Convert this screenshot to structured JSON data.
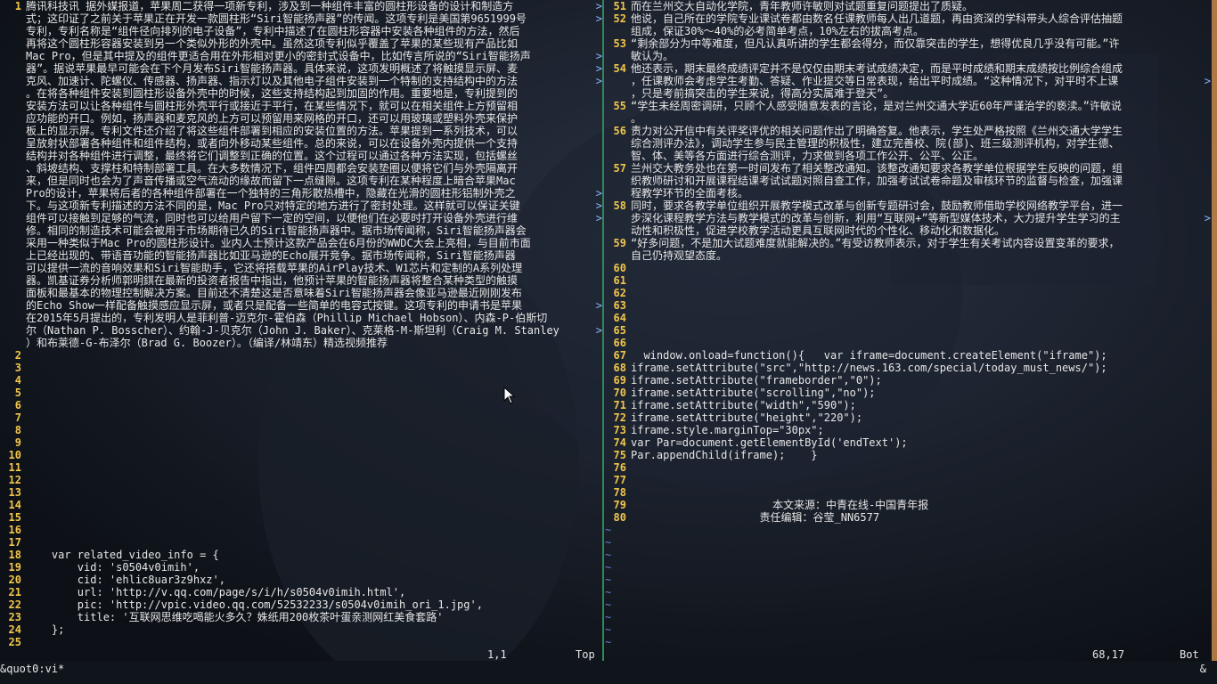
{
  "colors": {
    "line_number": "#f2c64a",
    "tilde": "#5e83c8",
    "divider": "#2f8a5a",
    "text": "#e6e6e6"
  },
  "left": {
    "lines": [
      {
        "ln": "1",
        "text": "腾讯科技讯 据外媒报道，苹果周二获得一项新专利，涉及到一种组件丰富的圆柱形设备的设计和制造方"
      },
      {
        "ln": "",
        "text": "式；这印证了之前关于苹果正在开发一款圆柱形“Siri智能扬声器”的传闻。这项专利是美国第9651999号"
      },
      {
        "ln": "",
        "text": "专利，专利名称是“组件径向排列的电子设备”，专利中描述了在圆柱形容器中安装各种组件的方法，然后"
      },
      {
        "ln": "",
        "text": "再将这个圆柱形容器安装到另一个类似外形的外壳中。虽然这项专利似乎覆盖了苹果的某些现有产品比如"
      },
      {
        "ln": "",
        "text": "Mac Pro，但是其中提及的组件更适合用在外形相对更小的密封式设备中，比如传言所说的“Siri智能扬声"
      },
      {
        "ln": "",
        "text": "器”。据说苹果最早可能会在下个月发布Siri智能扬声器。具体来说，这项发明概述了将触摸显示屏、麦"
      },
      {
        "ln": "",
        "text": "克风、加速计、陀螺仪、传感器、扬声器、指示灯以及其他电子组件安装到一个特制的支持结构中的方法"
      },
      {
        "ln": "",
        "text": "。在将各种组件安装到圆柱形设备外壳中的时候，这些支持结构起到加固的作用。重要地是，专利提到的"
      },
      {
        "ln": "",
        "text": "安装方法可以让各种组件与圆柱形外壳平行或接近于平行，在某些情况下，就可以在相关组件上方预留相"
      },
      {
        "ln": "",
        "text": "应功能的开口。例如，扬声器和麦克风的上方可以预留用来网格的开口，还可以用玻璃或塑料外壳来保护"
      },
      {
        "ln": "",
        "text": "板上的显示屏。专利文件还介绍了将这些组件部署到相应的安装位置的方法。苹果提到一系列技术，可以"
      },
      {
        "ln": "",
        "text": "呈放射状部署各种组件和组件结构，或者向外移动某些组件。总的来说，可以在设备外壳内提供一个支持"
      },
      {
        "ln": "",
        "text": "结构并对各种组件进行调整，最终将它们调整到正确的位置。这个过程可以通过各种方法实现，包括螺丝"
      },
      {
        "ln": "",
        "text": "、斜坡结构、支撑柱和特制部署工具。在大多数情况下，组件四周都会安装垫圈以便将它们与外壳隔离开"
      },
      {
        "ln": "",
        "text": "来，但是同时也会为了声音传播或空气流动的缘故而留下一点缝隙。这项专利在某种程度上暗合苹果Mac"
      },
      {
        "ln": "",
        "text": "Pro的设计，苹果将后者的各种组件部署在一个独特的三角形散热槽中，隐藏在光滑的圆柱形铝制外壳之"
      },
      {
        "ln": "",
        "text": "下。与这项新专利描述的方法不同的是，Mac Pro只对特定的地方进行了密封处理。这样就可以保证关键"
      },
      {
        "ln": "",
        "text": "组件可以接触到足够的气流，同时也可以给用户留下一定的空间，以便他们在必要时打开设备外壳进行维"
      },
      {
        "ln": "",
        "text": "修。相同的制造技术可能会被用于市场期待已久的Siri智能扬声器中。据市场传闻称，Siri智能扬声器会"
      },
      {
        "ln": "",
        "text": "采用一种类似于Mac Pro的圆柱形设计。业内人士预计这款产品会在6月份的WWDC大会上亮相，与目前市面"
      },
      {
        "ln": "",
        "text": "上已经出现的、带语音功能的智能扬声器比如亚马逊的Echo展开竞争。据市场传闻称，Siri智能扬声器"
      },
      {
        "ln": "",
        "text": "可以提供一流的音响效果和Siri智能助手，它还将搭载苹果的AirPlay技术、W1芯片和定制的A系列处理"
      },
      {
        "ln": "",
        "text": "器。凯基证券分析师郭明錤在最新的投资者报告中指出，他预计苹果的智能扬声器将整合某种类型的触摸"
      },
      {
        "ln": "",
        "text": "面板和最基本的物理控制解决方案。目前还不清楚这是否意味着Siri智能扬声器会像亚马逊最近刚刚发布"
      },
      {
        "ln": "",
        "text": "的Echo Show一样配备触摸感应显示屏，或者只是配备一些简单的电容式按键。这项专利的申请书是苹果"
      },
      {
        "ln": "",
        "text": "在2015年5月提出的，专利发明人是菲利普-迈克尔-霍伯森（Phillip Michael Hobson）、内森-P-伯斯切"
      },
      {
        "ln": "",
        "text": "尔（Nathan P. Bosscher）、约翰-J-贝克尔（John J. Baker）、克莱格-M-斯坦利（Craig M. Stanley"
      },
      {
        "ln": "",
        "text": "）和布莱德-G-布泽尔（Brad G. Boozer）。（编译/林靖东）精选视频推荐"
      },
      {
        "ln": "2",
        "text": ""
      },
      {
        "ln": "3",
        "text": ""
      },
      {
        "ln": "4",
        "text": ""
      },
      {
        "ln": "5",
        "text": ""
      },
      {
        "ln": "6",
        "text": ""
      },
      {
        "ln": "7",
        "text": ""
      },
      {
        "ln": "8",
        "text": ""
      },
      {
        "ln": "9",
        "text": ""
      },
      {
        "ln": "10",
        "text": ""
      },
      {
        "ln": "11",
        "text": ""
      },
      {
        "ln": "12",
        "text": ""
      },
      {
        "ln": "13",
        "text": ""
      },
      {
        "ln": "14",
        "text": ""
      },
      {
        "ln": "15",
        "text": ""
      },
      {
        "ln": "16",
        "text": ""
      },
      {
        "ln": "17",
        "text": ""
      },
      {
        "ln": "18",
        "text": "    var related_video_info = {"
      },
      {
        "ln": "19",
        "text": "        vid: 's0504v0imih',"
      },
      {
        "ln": "20",
        "text": "        cid: 'ehlic8uar3z9hxz',"
      },
      {
        "ln": "21",
        "text": "        url: 'http://v.qq.com/page/s/i/h/s0504v0imih.html',"
      },
      {
        "ln": "22",
        "text": "        pic: 'http://vpic.video.qq.com/52532233/s0504v0imih_ori_1.jpg',"
      },
      {
        "ln": "23",
        "text": "        title: '互联网思维吃喝能火多久？姝纸用200枚茶叶蛋亲测网红美食套路'"
      },
      {
        "ln": "24",
        "text": "    };"
      },
      {
        "ln": "25",
        "text": ""
      }
    ],
    "cont_rows": [
      0,
      1,
      4,
      5,
      6,
      15,
      16,
      17,
      24,
      26
    ],
    "status_pos": "1,1",
    "status_scroll": "Top"
  },
  "right": {
    "lines": [
      {
        "ln": "51",
        "text": "而在兰州交大自动化学院，青年教师许敏则对试题重复问题提出了质疑。"
      },
      {
        "ln": "52",
        "text": "他说，自己所在的学院专业课试卷都由数名任课教师每人出几道题，再由资深的学科带头人综合评估抽题"
      },
      {
        "ln": "",
        "text": "组成，保证30%～40%的必考简单考点，10%左右的拔高考点。"
      },
      {
        "ln": "53",
        "text": "“剩余部分为中等难度，但凡认真听讲的学生都会得分，而仅靠突击的学生，想得优良几乎没有可能。”许"
      },
      {
        "ln": "",
        "text": "敏认为。"
      },
      {
        "ln": "54",
        "text": "他还表示，期末最终成绩评定并不是仅仅由期末考试成绩决定，而是平时成绩和期末成绩按比例综合组成"
      },
      {
        "ln": "",
        "text": "，任课教师会考虑学生考勤、答疑、作业提交等日常表现，给出平时成绩。“这种情况下，对平时不上课"
      },
      {
        "ln": "",
        "text": "，只是考前搞突击的学生来说，得高分实属难于登天”。"
      },
      {
        "ln": "55",
        "text": "“学生未经周密调研，只顾个人感受随意发表的言论，是对兰州交通大学近60年严谨治学的亵渎。”许敏说"
      },
      {
        "ln": "",
        "text": "。"
      },
      {
        "ln": "56",
        "text": "责力对公开信中有关评奖评优的相关问题作出了明确答复。他表示，学生处严格按照《兰州交通大学学生"
      },
      {
        "ln": "",
        "text": "综合测评办法》，调动学生参与民主管理的积极性，建立完善校、院(部)、班三级测评机构，对学生德、"
      },
      {
        "ln": "",
        "text": "智、体、美等各方面进行综合测评，力求做到各项工作公开、公平、公正。"
      },
      {
        "ln": "57",
        "text": "兰州交大教务处也在第一时间发布了相关整改通知。该整改通知要求各教学单位根据学生反映的问题，组"
      },
      {
        "ln": "",
        "text": "织教师研讨和开展课程结课考试试题对照自查工作，加强考试试卷命题及审核环节的监督与检查，加强课"
      },
      {
        "ln": "",
        "text": "程教学环节的全面考核。"
      },
      {
        "ln": "58",
        "text": "同时，要求各教学单位组织开展教学模式改革与创新专题研讨会，鼓励教师借助学校网络教学平台，进一"
      },
      {
        "ln": "",
        "text": "步深化课程教学方法与教学模式的改革与创新，利用“互联网+”等新型媒体技术，大力提升学生学习的主"
      },
      {
        "ln": "",
        "text": "动性和积极性，促进学校教学活动更具互联网时代的个性化、移动化和数据化。"
      },
      {
        "ln": "59",
        "text": "“好多问题，不是加大试题难度就能解决的。”有受访教师表示，对于学生有关考试内容设置变革的要求，"
      },
      {
        "ln": "",
        "text": "自己仍持观望态度。"
      },
      {
        "ln": "60",
        "text": ""
      },
      {
        "ln": "61",
        "text": ""
      },
      {
        "ln": "62",
        "text": ""
      },
      {
        "ln": "63",
        "text": ""
      },
      {
        "ln": "64",
        "text": ""
      },
      {
        "ln": "65",
        "text": ""
      },
      {
        "ln": "66",
        "text": ""
      },
      {
        "ln": "67",
        "text": "  window.onload=function(){   var iframe=document.createElement(\"iframe\");"
      },
      {
        "ln": "68",
        "text": "iframe.setAttribute(\"src\",\"http://news.163.com/special/today_must_news/\");"
      },
      {
        "ln": "69",
        "text": "iframe.setAttribute(\"frameborder\",\"0\");"
      },
      {
        "ln": "70",
        "text": "iframe.setAttribute(\"scrolling\",\"no\");"
      },
      {
        "ln": "71",
        "text": "iframe.setAttribute(\"width\",\"590\");"
      },
      {
        "ln": "72",
        "text": "iframe.setAttribute(\"height\",\"220\");"
      },
      {
        "ln": "73",
        "text": "iframe.style.marginTop=\"30px\";"
      },
      {
        "ln": "74",
        "text": "var Par=document.getElementById('endText');"
      },
      {
        "ln": "75",
        "text": "Par.appendChild(iframe);    }"
      },
      {
        "ln": "76",
        "text": ""
      },
      {
        "ln": "77",
        "text": ""
      },
      {
        "ln": "78",
        "text": ""
      },
      {
        "ln": "79",
        "text": "                      本文来源：中青在线-中国青年报"
      },
      {
        "ln": "80",
        "text": "                    责任编辑：谷莹_NN6577"
      },
      {
        "ln": "~",
        "text": ""
      },
      {
        "ln": "~",
        "text": ""
      },
      {
        "ln": "~",
        "text": ""
      },
      {
        "ln": "~",
        "text": ""
      },
      {
        "ln": "~",
        "text": ""
      },
      {
        "ln": "~",
        "text": ""
      },
      {
        "ln": "~",
        "text": ""
      },
      {
        "ln": "~",
        "text": ""
      },
      {
        "ln": "~",
        "text": ""
      },
      {
        "ln": "~",
        "text": ""
      }
    ],
    "cont_rows": [
      6,
      17
    ],
    "status_pos": "68,17",
    "status_scroll": "Bot"
  },
  "cmdline": {
    "text": "&quot0:vi*",
    "amp": "&"
  },
  "cont_glyph": ">"
}
